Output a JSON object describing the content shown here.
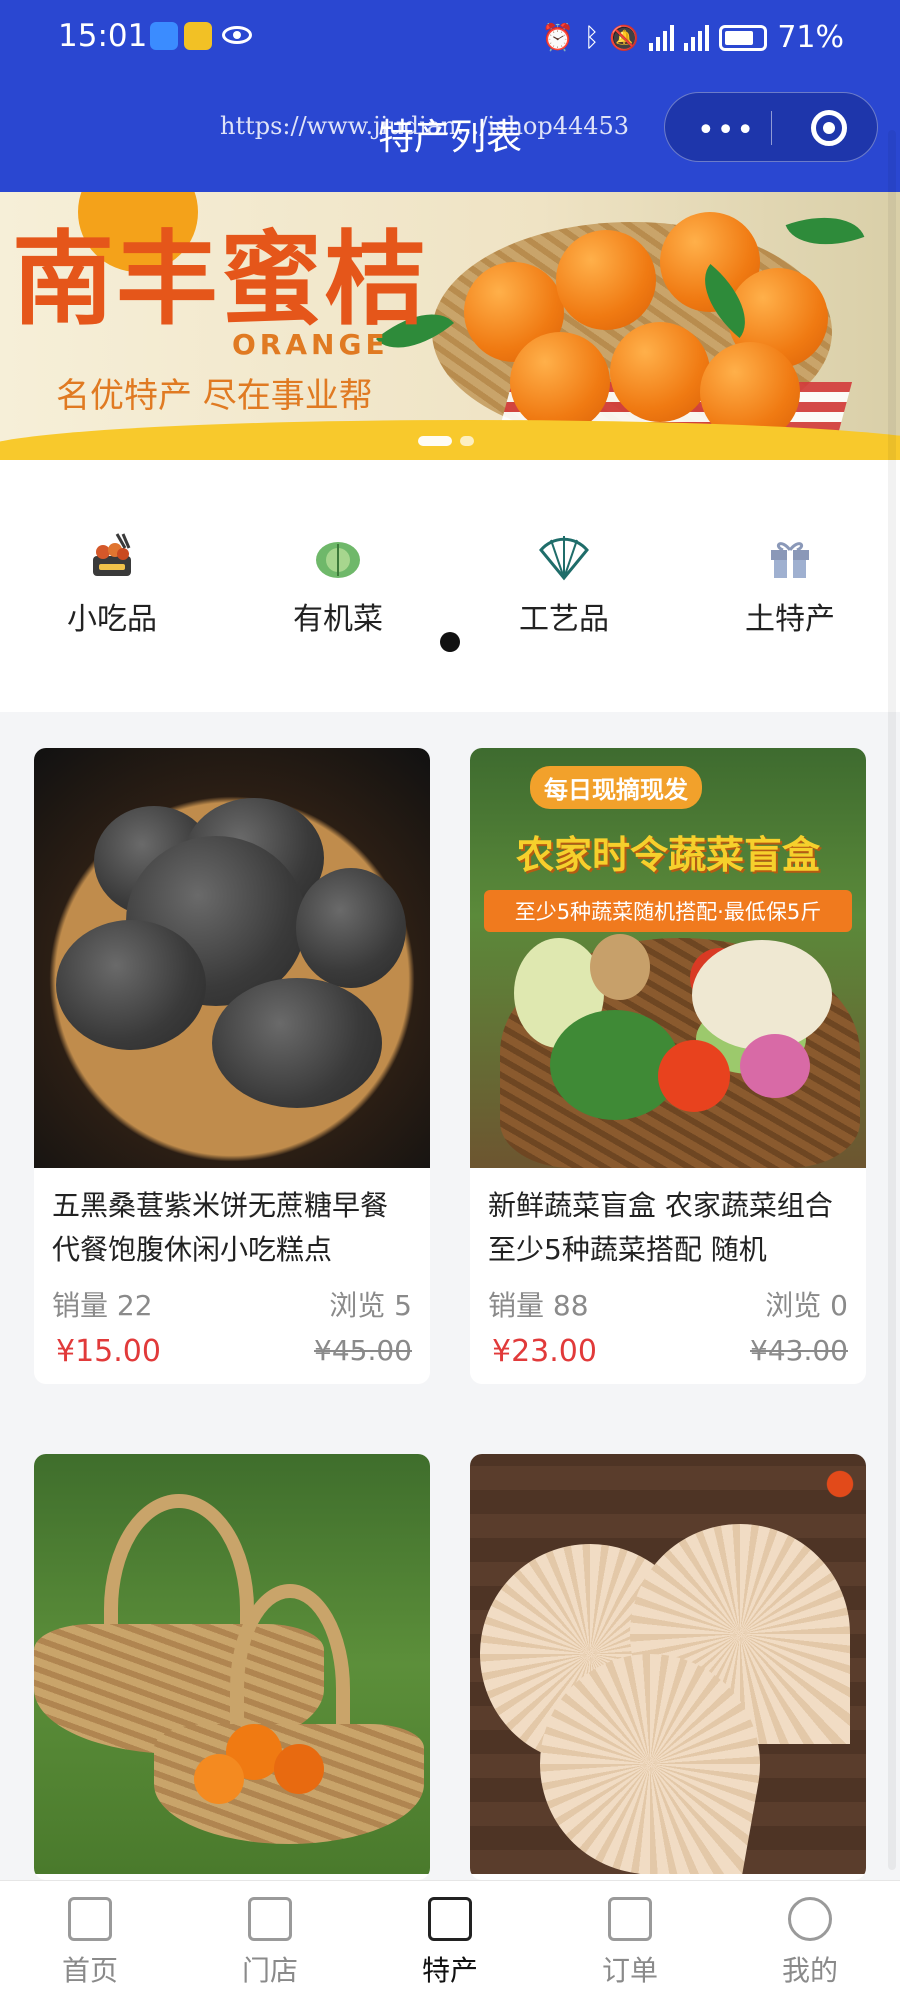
{
  "status_bar": {
    "time": "15:01",
    "battery": "71%",
    "network": "4G"
  },
  "header": {
    "title": "特产列表",
    "url_overlay": "https://www.jiudian.../ishop44453",
    "menu_dots": "•••"
  },
  "banner": {
    "title": "南丰蜜桔",
    "subtitle_en": "ORANGE",
    "slogan": "名优特产  尽在事业帮"
  },
  "categories": [
    {
      "label": "小吃品",
      "icon": "snack-icon"
    },
    {
      "label": "有机菜",
      "icon": "cabbage-icon"
    },
    {
      "label": "工艺品",
      "icon": "fan-icon"
    },
    {
      "label": "土特产",
      "icon": "gift-icon"
    }
  ],
  "products": [
    {
      "name": "五黑桑葚紫米饼无蔗糖早餐代餐饱腹休闲小吃糕点",
      "sales_label": "销量 22",
      "views_label": "浏览 5",
      "price": "¥15.00",
      "original_price": "¥45.00"
    },
    {
      "name": "新鲜蔬菜盲盒 农家蔬菜组合 至少5种蔬菜搭配 随机",
      "sales_label": "销量 88",
      "views_label": "浏览 0",
      "price": "¥23.00",
      "original_price": "¥43.00",
      "image_text": {
        "tag": "每日现摘现发",
        "headline": "农家时令蔬菜盲盒",
        "bar": "至少5种蔬菜随机搭配·最低保5斤"
      }
    },
    {
      "name": "",
      "image": "basket"
    },
    {
      "name": "",
      "image": "fans"
    }
  ],
  "tabbar": [
    {
      "label": "首页",
      "icon": "building-icon"
    },
    {
      "label": "门店",
      "icon": "store-icon"
    },
    {
      "label": "特产",
      "icon": "bag-icon",
      "active": true
    },
    {
      "label": "订单",
      "icon": "clipboard-icon"
    },
    {
      "label": "我的",
      "icon": "user-icon"
    }
  ],
  "colors": {
    "header_blue": "#2a47d1",
    "price_red": "#e13a3a",
    "banner_orange": "#e5561a"
  }
}
